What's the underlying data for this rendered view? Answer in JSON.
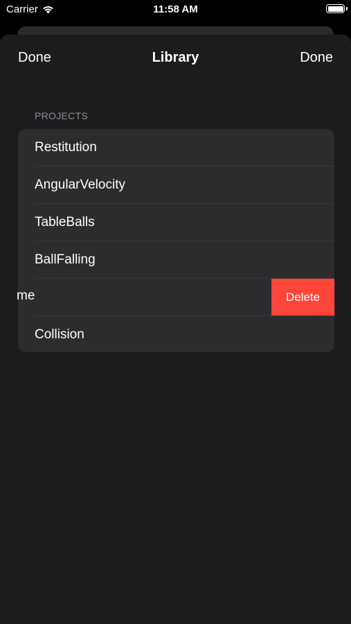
{
  "status_bar": {
    "carrier": "Carrier",
    "time": "11:58 AM"
  },
  "nav": {
    "left_button": "Done",
    "title": "Library",
    "right_button": "Done"
  },
  "section": {
    "header": "PROJECTS"
  },
  "rows": [
    {
      "label": "Restitution"
    },
    {
      "label": "AngularVelocity"
    },
    {
      "label": "TableBalls"
    },
    {
      "label": "BallFalling"
    },
    {
      "label": "me",
      "swiped": true,
      "action": "Delete"
    },
    {
      "label": "Collision"
    }
  ],
  "colors": {
    "sheet_bg": "#1c1c1e",
    "row_bg": "#2c2c2e",
    "delete": "#ff453a",
    "section_header": "#8d8d93"
  }
}
